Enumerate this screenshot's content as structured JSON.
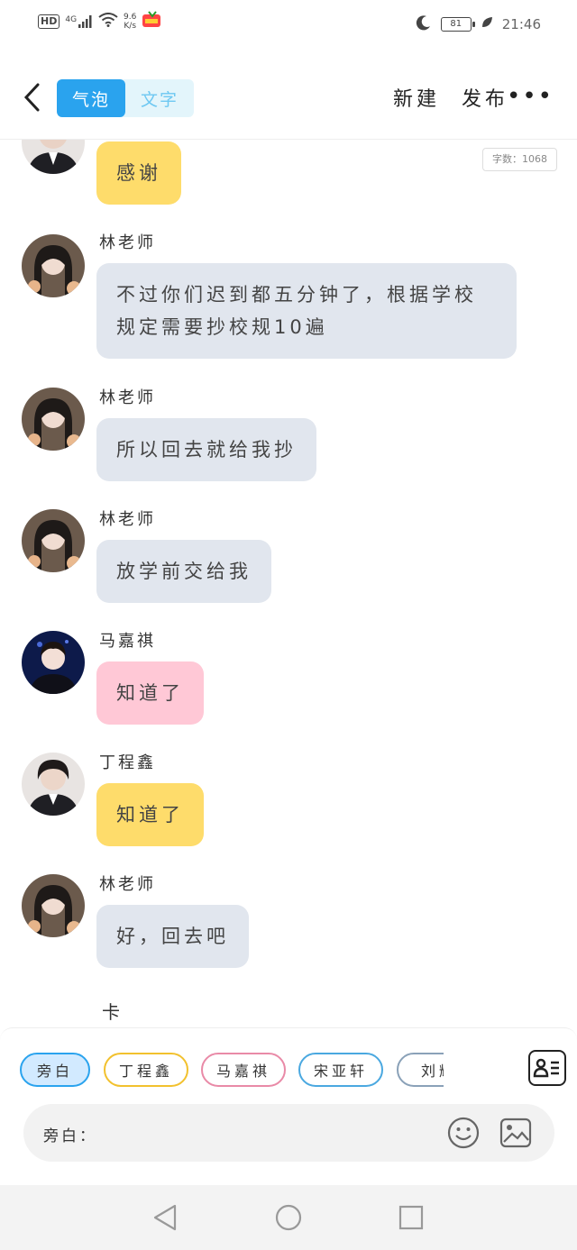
{
  "status_bar": {
    "hd": "HD",
    "signal": "4G",
    "speed_value": "9.6",
    "speed_unit": "K/s",
    "battery": "81",
    "time": "21:46"
  },
  "header": {
    "tab_bubble": "气泡",
    "tab_text": "文字",
    "new_label": "新建",
    "publish_label": "发布",
    "more_label": "•••"
  },
  "word_count": "字数：1068",
  "messages": [
    {
      "name": "",
      "text": "感谢"
    },
    {
      "name": "林老师",
      "text": "不过你们迟到都五分钟了，根据学校规定需要抄校规10遍"
    },
    {
      "name": "林老师",
      "text": "所以回去就给我抄"
    },
    {
      "name": "林老师",
      "text": "放学前交给我"
    },
    {
      "name": "马嘉祺",
      "text": "知道了"
    },
    {
      "name": "丁程鑫",
      "text": "知道了"
    },
    {
      "name": "林老师",
      "text": "好，回去吧"
    }
  ],
  "narration_preview": "卡",
  "roles": [
    "旁白",
    "丁程鑫",
    "马嘉祺",
    "宋亚轩",
    "刘耀"
  ],
  "role_colors": {
    "narrator": "#2aa3ee",
    "ding": "#f2c12e",
    "ma": "#e98aa7",
    "song": "#4aa8e0",
    "liu": "#8aa1b8"
  },
  "input": {
    "label": "旁白："
  }
}
